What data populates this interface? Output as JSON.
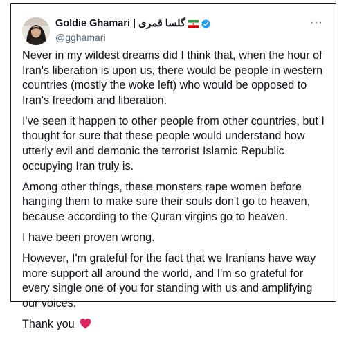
{
  "author": {
    "display_name": "Goldie Ghamari | گلسا قمری",
    "flag_icon": "iran-flag-icon",
    "verified_icon": "verified-badge-icon",
    "handle": "@gghamari",
    "avatar": "author-avatar"
  },
  "more_label": "···",
  "paragraphs": [
    "Never in my wildest dreams did I think that, when the hour of Iran's liberation is upon us, there would be people in western countries (mostly the woke left) who would be opposed to Iran's freedom and liberation.",
    "I've seen it happen to other people from other countries, but I thought for sure that these people would understand how utterly evil and demonic the terrorist Islamic Republic occupying Iran truly is.",
    "Among other things, these monsters rape women before hanging them to make sure their souls don't go to heaven, because according to the Quran virgins go to heaven.",
    "I have been proven wrong.",
    "However, I'm grateful for the fact that we Iranians have way more support all around the world, and I'm so grateful for every single one of you for standing with us and amplifying our voices."
  ],
  "closing": "Thank you",
  "closing_icon": "red-heart-icon",
  "colors": {
    "text": "#0f1419",
    "secondary_text": "#536471",
    "verified_blue": "#1d9bf0",
    "heart_red": "#e0245e"
  }
}
